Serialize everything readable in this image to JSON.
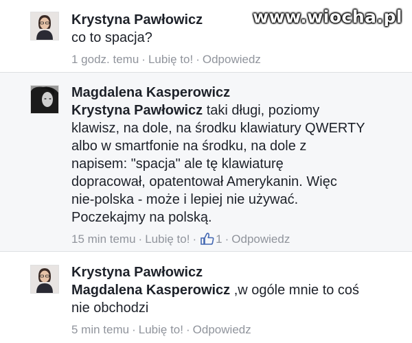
{
  "watermark": "www.wiocha.pl",
  "comments": [
    {
      "author": "Krystyna Pawłowicz",
      "text": "co to spacja?",
      "time": "1 godz. temu",
      "like": "Lubię to!",
      "reply": "Odpowiedz"
    },
    {
      "author": "Magdalena Kasperowicz",
      "mention": "Krystyna Pawłowicz",
      "text_lines": [
        " taki długi, poziomy",
        "klawisz, na dole, na środku klawiatury QWERTY",
        "albo w smartfonie na środku, na dole z",
        "napisem: \"spacja\" ale tę klawiaturę",
        "dopracował, opatentował Amerykanin. Więc",
        "nie-polska - może i lepiej nie używać.",
        "Poczekajmy na polską."
      ],
      "time": "15 min temu",
      "like": "Lubię to!",
      "like_count": "1",
      "reply": "Odpowiedz",
      "icon": "thumbs-up-icon"
    },
    {
      "author": "Krystyna Pawłowicz",
      "mention": "Magdalena Kasperowicz",
      "text_lines": [
        " ,w ogóle mnie to coś",
        "nie obchodzi"
      ],
      "time": "5 min temu",
      "like": "Lubię to!",
      "reply": "Odpowiedz"
    }
  ],
  "colors": {
    "meta": "#90949c",
    "like_blue": "#4267b2",
    "separator": "#dddfe2"
  }
}
